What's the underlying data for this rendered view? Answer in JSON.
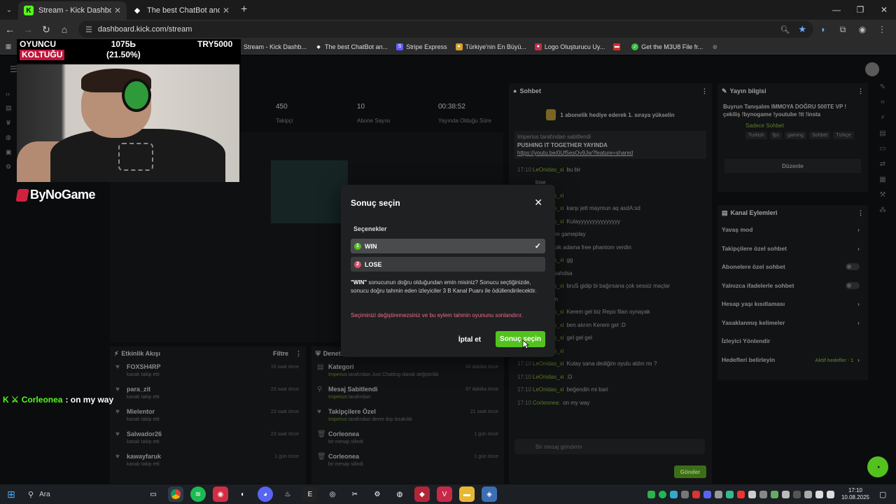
{
  "browser": {
    "tabs": [
      {
        "label": "Stream - Kick Dashboard",
        "active": true,
        "favicon": "K"
      },
      {
        "label": "The best ChatBot and Widgets",
        "active": false,
        "favicon": "◆"
      }
    ],
    "url": "dashboard.kick.com/stream",
    "bookmarks": [
      "Stream - Kick Dashb...",
      "The best ChatBot an...",
      "Stripe Express",
      "Türkiye'nin En Büyü...",
      "Logo Oluşturucu Uy...",
      "Get the M3U8 File fr..."
    ]
  },
  "overlay": {
    "left_line1": "OYUNCU",
    "left_line2": "KOLTUĞU",
    "mid_line1": "1075Ь",
    "mid_line2": "(21.50%)",
    "right": "TRY5000",
    "brand": "ByNoGame",
    "follow_user": "Corleonea",
    "follow_msg": ": on my way"
  },
  "stats": [
    {
      "num": "450",
      "label": "Takipçi"
    },
    {
      "num": "10",
      "label": "Abone Sayısı"
    },
    {
      "num": "00:38:52",
      "label": "Yayında Olduğu Süre"
    }
  ],
  "activity": {
    "title": "Etkinlik Akışı",
    "filter": "Filtre",
    "rows": [
      {
        "name": "FOXSH4RP",
        "sub": "kanalı takip etti",
        "time": "15 saat önce"
      },
      {
        "name": "para_zit",
        "sub": "kanalı takip etti",
        "time": "23 saat önce"
      },
      {
        "name": "Mielentor",
        "sub": "kanalı takip etti",
        "time": "23 saat önce"
      },
      {
        "name": "Salwador26",
        "sub": "kanalı takip etti",
        "time": "23 saat önce"
      },
      {
        "name": "kawayfaruk",
        "sub": "kanalı takip etti",
        "time": "1 gün önce"
      }
    ]
  },
  "commands": {
    "title": "Denetim",
    "rows": [
      {
        "name": "Kategori",
        "user": "Imperius",
        "sub": "tarafından Just Chatting olarak değiştirildi",
        "time": "34 dakika önce"
      },
      {
        "name": "Mesaj Sabitlendi",
        "user": "Imperius",
        "sub": "tarafından",
        "time": "37 dakika önce"
      },
      {
        "name": "Takipçilere Özel",
        "user": "Imperius",
        "sub": "tarafından devre dışı bırakıldı",
        "time": "21 saat önce"
      },
      {
        "name": "Corleonea",
        "user": "",
        "sub": "bir mesajı silindi",
        "time": "1 gün önce"
      },
      {
        "name": "Corleonea",
        "user": "",
        "sub": "bir mesajı silindi",
        "time": "1 gün önce"
      }
    ]
  },
  "chat": {
    "title": "Sohbet",
    "promo": "1 abonelik hediye ederek 1. sıraya yükselin",
    "pinned_by": "Imperius tarafından sabitlendi",
    "pinned_title": "PUSHING IT TOGETHER YAYINDA",
    "pinned_link": "https://youtu.be/0Uf5esOv9Jw?feature=shared",
    "lines": [
      {
        "t": "17:10",
        "u": "LeOnidas_xi",
        "m": "bu bir"
      },
      {
        "t": "",
        "u": "",
        "m": "lose"
      },
      {
        "t": "",
        "u": "LeOnidas_xi",
        "m": ""
      },
      {
        "t": "",
        "u": "LeOnidas_xi",
        "m": "karşı jett maymun aq asdA:sd"
      },
      {
        "t": "",
        "u": "LeOnidas_xi",
        "m": "Kutayyyyyyyyyyyyyyy"
      },
      {
        "t": "",
        "u": "",
        "m": "1 iç omen gameplay"
      },
      {
        "t": "",
        "u": "",
        "m": "ne pompik adama free phantom verdin"
      },
      {
        "t": "",
        "u": "LeOnidas_xi",
        "m": "gg"
      },
      {
        "t": "",
        "u": "",
        "m": "ahhahdsahdsa"
      },
      {
        "t": "",
        "u": "LeOnidas_xi",
        "m": "bruS gidip bi bağırsana çok sessiz maçlar"
      },
      {
        "t": "",
        "u": "",
        "m": "çıkmasın"
      },
      {
        "t": "",
        "u": "LeOnidas_xi",
        "m": "Kerem gel biz Repo filan oynayak"
      },
      {
        "t": "",
        "u": "LeOnidas_xi",
        "m": "ben alırım Kerem gel :D"
      },
      {
        "t": "",
        "u": "LeOnidas_xi",
        "m": "gel gel gel"
      },
      {
        "t": "17:09",
        "u": "LeOnidas_xi",
        "m": ""
      },
      {
        "t": "17:10",
        "u": "LeOnidas_xi",
        "m": "Kutay sana dediğim oyulu aldın mı ?"
      },
      {
        "t": "17:10",
        "u": "LeOnidas_xi",
        "m": ":D"
      },
      {
        "t": "17:10",
        "u": "LeOnidas_xi",
        "m": "beğendin mi bari"
      },
      {
        "t": "17:10",
        "u": "Corleonea:",
        "m": "on my way"
      }
    ],
    "input_placeholder": "Bir mesaj gönderin",
    "send": "Gönder"
  },
  "info": {
    "title": "Yayın bilgisi",
    "text": "Buyrun Tanışalım IMMOYA DOĞRU 500TE VP ! çekiliş !bynogame !youtube !tt !insta",
    "category": "Sadece Sohbet",
    "tags": [
      "Turkish",
      "fps",
      "gaming",
      "Sohbet",
      "Türkçe"
    ],
    "edit": "Düzenle"
  },
  "channel_actions": {
    "title": "Kanal Eylemleri",
    "rows": [
      {
        "label": "Yavaş mod",
        "kind": "arrow"
      },
      {
        "label": "Takipçilere özel sohbet",
        "kind": "arrow"
      },
      {
        "label": "Abonelere özel sohbet",
        "kind": "toggle"
      },
      {
        "label": "Yalnızca ifadelerle sohbet",
        "kind": "toggle"
      },
      {
        "label": "Hesap yaşı kısıtlaması",
        "kind": "arrow"
      },
      {
        "label": "Yasaklanmış kelimeler",
        "kind": "arrow"
      },
      {
        "label": "İzleyici Yönlendir",
        "kind": "none"
      },
      {
        "label": "Hedefleri belirleyin",
        "kind": "arrow",
        "extra": "Aktif hedefler · 1"
      }
    ]
  },
  "modal": {
    "title": "Sonuç seçin",
    "options_label": "Seçenekler",
    "options": [
      {
        "num": "1",
        "label": "WIN",
        "selected": true
      },
      {
        "num": "2",
        "label": "LOSE",
        "selected": false
      }
    ],
    "desc_strong": "\"WIN\"",
    "desc": " sonucunun doğru olduğundan emin misiniz? Sonucu seçtiğinizde, sonucu doğru tahmin eden izleyiciler 3 B Kanal Puanı ile ödüllendirilecektir.",
    "warning": "Seçiminizi değiştiremezsiniz ve bu eylem tahmin oyununu sonlandırır.",
    "cancel": "İptal et",
    "confirm": "Sonuç seçin"
  },
  "taskbar": {
    "search": "Ara",
    "time": "17:10",
    "date": "10.08.2025"
  },
  "colors": {
    "accent": "#53c21f",
    "warning": "#f06a8a",
    "modal_bg": "#1f2021"
  }
}
